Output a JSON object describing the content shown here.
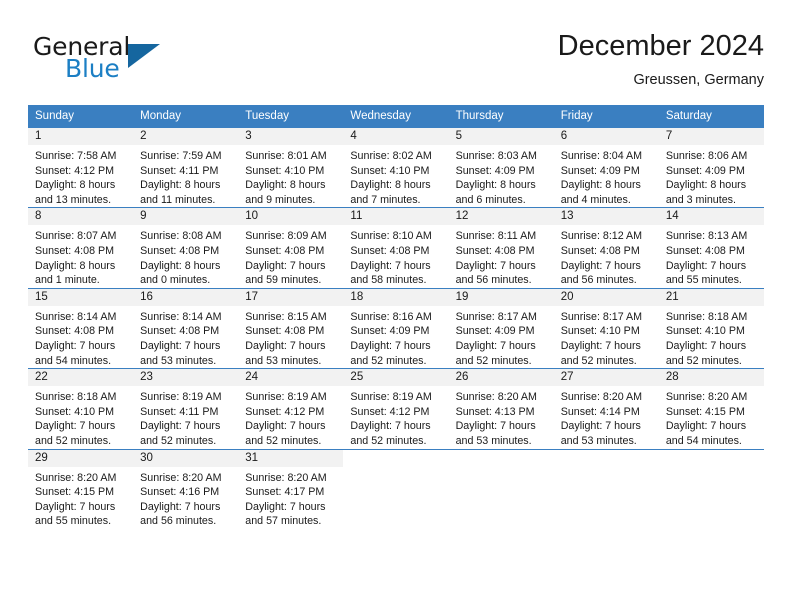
{
  "logo": {
    "word_one": "General",
    "word_two": "Blue",
    "triangle_icon": "triangle-icon",
    "brand_blue": "#1c7fc4",
    "triangle_color": "#15669f"
  },
  "header": {
    "title": "December 2024",
    "subtitle": "Greussen, Germany"
  },
  "calendar": {
    "header_bg": "#3a7fc1",
    "daynum_bg": "#f2f2f2",
    "weekday_headers": [
      "Sunday",
      "Monday",
      "Tuesday",
      "Wednesday",
      "Thursday",
      "Friday",
      "Saturday"
    ],
    "weeks": [
      [
        {
          "day": "1",
          "sunrise": "Sunrise: 7:58 AM",
          "sunset": "Sunset: 4:12 PM",
          "daylight_line1": "Daylight: 8 hours",
          "daylight_line2": "and 13 minutes."
        },
        {
          "day": "2",
          "sunrise": "Sunrise: 7:59 AM",
          "sunset": "Sunset: 4:11 PM",
          "daylight_line1": "Daylight: 8 hours",
          "daylight_line2": "and 11 minutes."
        },
        {
          "day": "3",
          "sunrise": "Sunrise: 8:01 AM",
          "sunset": "Sunset: 4:10 PM",
          "daylight_line1": "Daylight: 8 hours",
          "daylight_line2": "and 9 minutes."
        },
        {
          "day": "4",
          "sunrise": "Sunrise: 8:02 AM",
          "sunset": "Sunset: 4:10 PM",
          "daylight_line1": "Daylight: 8 hours",
          "daylight_line2": "and 7 minutes."
        },
        {
          "day": "5",
          "sunrise": "Sunrise: 8:03 AM",
          "sunset": "Sunset: 4:09 PM",
          "daylight_line1": "Daylight: 8 hours",
          "daylight_line2": "and 6 minutes."
        },
        {
          "day": "6",
          "sunrise": "Sunrise: 8:04 AM",
          "sunset": "Sunset: 4:09 PM",
          "daylight_line1": "Daylight: 8 hours",
          "daylight_line2": "and 4 minutes."
        },
        {
          "day": "7",
          "sunrise": "Sunrise: 8:06 AM",
          "sunset": "Sunset: 4:09 PM",
          "daylight_line1": "Daylight: 8 hours",
          "daylight_line2": "and 3 minutes."
        }
      ],
      [
        {
          "day": "8",
          "sunrise": "Sunrise: 8:07 AM",
          "sunset": "Sunset: 4:08 PM",
          "daylight_line1": "Daylight: 8 hours",
          "daylight_line2": "and 1 minute."
        },
        {
          "day": "9",
          "sunrise": "Sunrise: 8:08 AM",
          "sunset": "Sunset: 4:08 PM",
          "daylight_line1": "Daylight: 8 hours",
          "daylight_line2": "and 0 minutes."
        },
        {
          "day": "10",
          "sunrise": "Sunrise: 8:09 AM",
          "sunset": "Sunset: 4:08 PM",
          "daylight_line1": "Daylight: 7 hours",
          "daylight_line2": "and 59 minutes."
        },
        {
          "day": "11",
          "sunrise": "Sunrise: 8:10 AM",
          "sunset": "Sunset: 4:08 PM",
          "daylight_line1": "Daylight: 7 hours",
          "daylight_line2": "and 58 minutes."
        },
        {
          "day": "12",
          "sunrise": "Sunrise: 8:11 AM",
          "sunset": "Sunset: 4:08 PM",
          "daylight_line1": "Daylight: 7 hours",
          "daylight_line2": "and 56 minutes."
        },
        {
          "day": "13",
          "sunrise": "Sunrise: 8:12 AM",
          "sunset": "Sunset: 4:08 PM",
          "daylight_line1": "Daylight: 7 hours",
          "daylight_line2": "and 56 minutes."
        },
        {
          "day": "14",
          "sunrise": "Sunrise: 8:13 AM",
          "sunset": "Sunset: 4:08 PM",
          "daylight_line1": "Daylight: 7 hours",
          "daylight_line2": "and 55 minutes."
        }
      ],
      [
        {
          "day": "15",
          "sunrise": "Sunrise: 8:14 AM",
          "sunset": "Sunset: 4:08 PM",
          "daylight_line1": "Daylight: 7 hours",
          "daylight_line2": "and 54 minutes."
        },
        {
          "day": "16",
          "sunrise": "Sunrise: 8:14 AM",
          "sunset": "Sunset: 4:08 PM",
          "daylight_line1": "Daylight: 7 hours",
          "daylight_line2": "and 53 minutes."
        },
        {
          "day": "17",
          "sunrise": "Sunrise: 8:15 AM",
          "sunset": "Sunset: 4:08 PM",
          "daylight_line1": "Daylight: 7 hours",
          "daylight_line2": "and 53 minutes."
        },
        {
          "day": "18",
          "sunrise": "Sunrise: 8:16 AM",
          "sunset": "Sunset: 4:09 PM",
          "daylight_line1": "Daylight: 7 hours",
          "daylight_line2": "and 52 minutes."
        },
        {
          "day": "19",
          "sunrise": "Sunrise: 8:17 AM",
          "sunset": "Sunset: 4:09 PM",
          "daylight_line1": "Daylight: 7 hours",
          "daylight_line2": "and 52 minutes."
        },
        {
          "day": "20",
          "sunrise": "Sunrise: 8:17 AM",
          "sunset": "Sunset: 4:10 PM",
          "daylight_line1": "Daylight: 7 hours",
          "daylight_line2": "and 52 minutes."
        },
        {
          "day": "21",
          "sunrise": "Sunrise: 8:18 AM",
          "sunset": "Sunset: 4:10 PM",
          "daylight_line1": "Daylight: 7 hours",
          "daylight_line2": "and 52 minutes."
        }
      ],
      [
        {
          "day": "22",
          "sunrise": "Sunrise: 8:18 AM",
          "sunset": "Sunset: 4:10 PM",
          "daylight_line1": "Daylight: 7 hours",
          "daylight_line2": "and 52 minutes."
        },
        {
          "day": "23",
          "sunrise": "Sunrise: 8:19 AM",
          "sunset": "Sunset: 4:11 PM",
          "daylight_line1": "Daylight: 7 hours",
          "daylight_line2": "and 52 minutes."
        },
        {
          "day": "24",
          "sunrise": "Sunrise: 8:19 AM",
          "sunset": "Sunset: 4:12 PM",
          "daylight_line1": "Daylight: 7 hours",
          "daylight_line2": "and 52 minutes."
        },
        {
          "day": "25",
          "sunrise": "Sunrise: 8:19 AM",
          "sunset": "Sunset: 4:12 PM",
          "daylight_line1": "Daylight: 7 hours",
          "daylight_line2": "and 52 minutes."
        },
        {
          "day": "26",
          "sunrise": "Sunrise: 8:20 AM",
          "sunset": "Sunset: 4:13 PM",
          "daylight_line1": "Daylight: 7 hours",
          "daylight_line2": "and 53 minutes."
        },
        {
          "day": "27",
          "sunrise": "Sunrise: 8:20 AM",
          "sunset": "Sunset: 4:14 PM",
          "daylight_line1": "Daylight: 7 hours",
          "daylight_line2": "and 53 minutes."
        },
        {
          "day": "28",
          "sunrise": "Sunrise: 8:20 AM",
          "sunset": "Sunset: 4:15 PM",
          "daylight_line1": "Daylight: 7 hours",
          "daylight_line2": "and 54 minutes."
        }
      ],
      [
        {
          "day": "29",
          "sunrise": "Sunrise: 8:20 AM",
          "sunset": "Sunset: 4:15 PM",
          "daylight_line1": "Daylight: 7 hours",
          "daylight_line2": "and 55 minutes."
        },
        {
          "day": "30",
          "sunrise": "Sunrise: 8:20 AM",
          "sunset": "Sunset: 4:16 PM",
          "daylight_line1": "Daylight: 7 hours",
          "daylight_line2": "and 56 minutes."
        },
        {
          "day": "31",
          "sunrise": "Sunrise: 8:20 AM",
          "sunset": "Sunset: 4:17 PM",
          "daylight_line1": "Daylight: 7 hours",
          "daylight_line2": "and 57 minutes."
        },
        {
          "day": "",
          "sunrise": "",
          "sunset": "",
          "daylight_line1": "",
          "daylight_line2": ""
        },
        {
          "day": "",
          "sunrise": "",
          "sunset": "",
          "daylight_line1": "",
          "daylight_line2": ""
        },
        {
          "day": "",
          "sunrise": "",
          "sunset": "",
          "daylight_line1": "",
          "daylight_line2": ""
        },
        {
          "day": "",
          "sunrise": "",
          "sunset": "",
          "daylight_line1": "",
          "daylight_line2": ""
        }
      ]
    ]
  }
}
